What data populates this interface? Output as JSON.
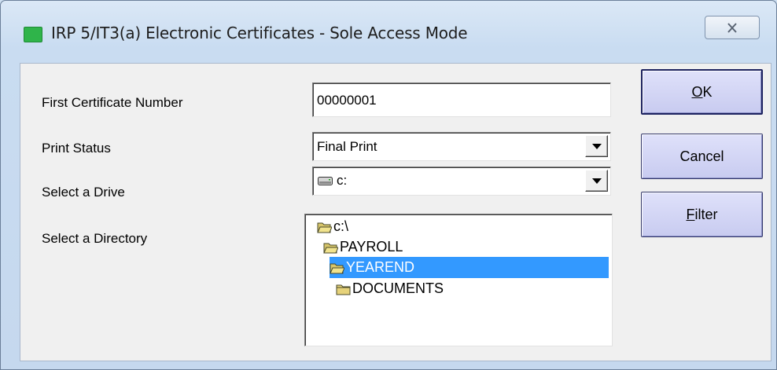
{
  "window": {
    "title": "IRP 5/IT3(a) Electronic Certificates - Sole Access Mode",
    "close_glyph": "✕",
    "app_icon": "green-square-icon",
    "app_icon_color": "#2fb44a"
  },
  "form": {
    "first_cert_label": "First Certificate Number",
    "first_cert_value": "00000001",
    "print_status_label": "Print Status",
    "print_status_value": "Final Print",
    "drive_label": "Select a Drive",
    "drive_value": "c:",
    "directory_label": "Select a Directory"
  },
  "directory_tree": [
    {
      "label": "c:\\",
      "selected": false
    },
    {
      "label": "PAYROLL",
      "selected": false
    },
    {
      "label": "YEAREND",
      "selected": true
    },
    {
      "label": "DOCUMENTS",
      "selected": false
    }
  ],
  "buttons": {
    "ok": {
      "accel": "O",
      "rest": "K"
    },
    "cancel": "Cancel",
    "filter": {
      "accel": "F",
      "rest": "ilter"
    }
  },
  "colors": {
    "selection": "#3399ff",
    "button_face": "#cfd2f4",
    "button_border": "#33386b"
  }
}
